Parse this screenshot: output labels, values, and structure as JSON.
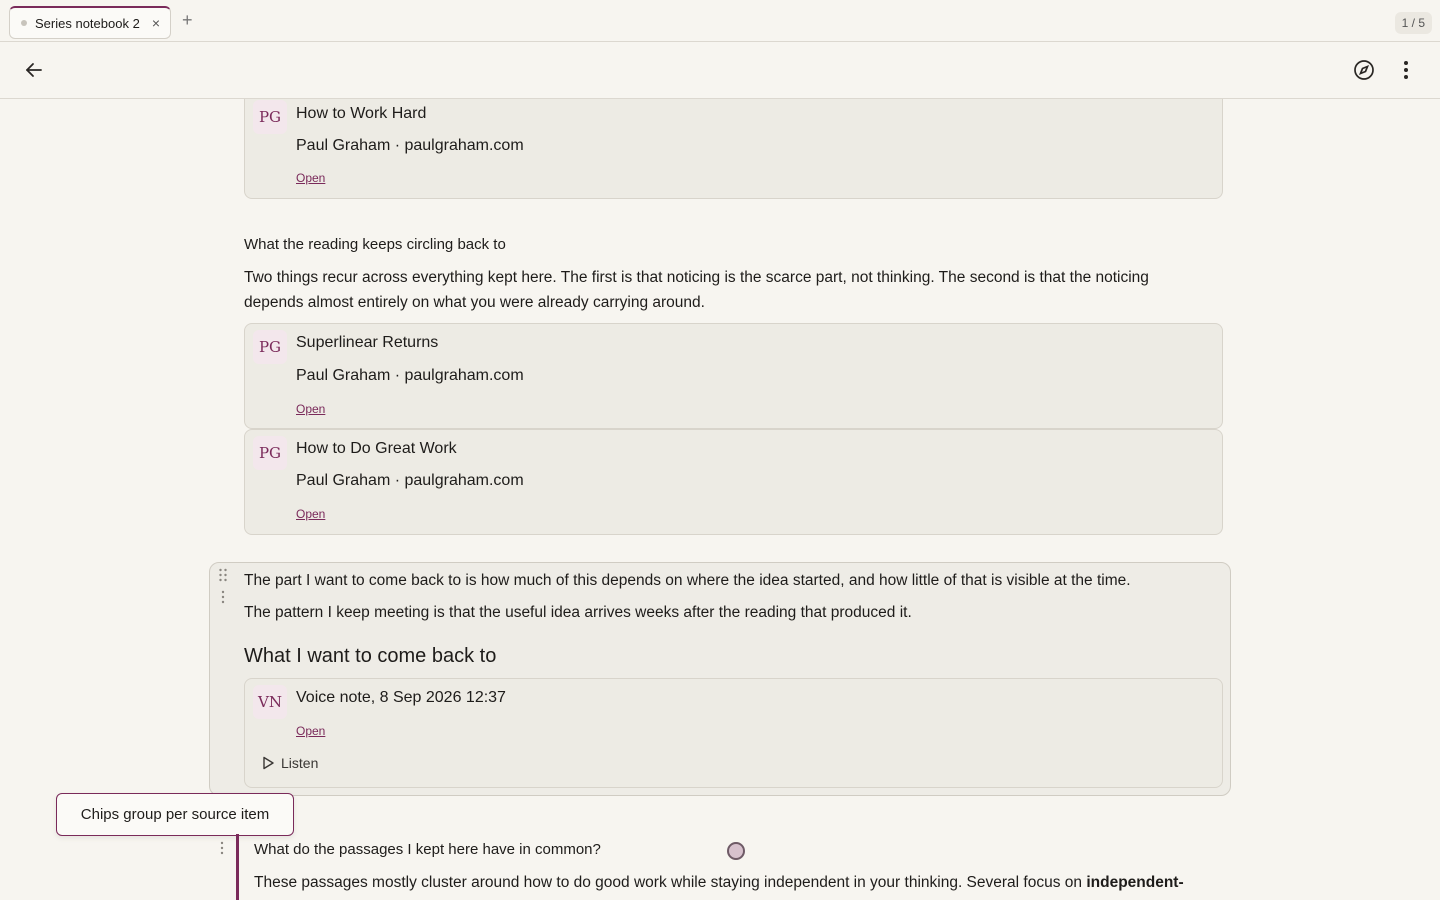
{
  "tabs": [
    {
      "label": "Series notebook 2",
      "active": true
    }
  ],
  "page_counter": "1 / 5",
  "cards": [
    {
      "initials": "PG",
      "title": "How to Work Hard",
      "meta": "Paul Graham · paulgraham.com",
      "open_label": "Open"
    },
    {
      "initials": "PG",
      "title": "Superlinear Returns",
      "meta": "Paul Graham · paulgraham.com",
      "open_label": "Open"
    },
    {
      "initials": "PG",
      "title": "How to Do Great Work",
      "meta": "Paul Graham · paulgraham.com",
      "open_label": "Open"
    },
    {
      "initials": "VN",
      "title": "Voice note, 8 Sep 2026 12:37",
      "meta": "",
      "open_label": "Open",
      "listen_label": "Listen"
    }
  ],
  "section": {
    "label": "What the reading keeps circling back to",
    "body": "Two things recur across everything kept here. The first is that noticing is the scarce part, not thinking. The second is that the noticing depends almost entirely on what you were already carrying around."
  },
  "block": {
    "para1": "The part I want to come back to is how much of this depends on where the idea started, and how little of that is visible at the time.",
    "para2": "The pattern I keep meeting is that the useful idea arrives weeks after the reading that produced it.",
    "heading": "What I want to come back to"
  },
  "tooltip": "Chips group per source item",
  "ai": {
    "question": "What do the passages I kept here have in common?",
    "answer_start": "These passages mostly cluster around how to do good work while staying independent in your thinking. Several focus on ",
    "answer_bold": "independent-"
  },
  "colors": {
    "accent": "#7a2a5a",
    "background": "#f7f5f0",
    "card": "#edebe4"
  },
  "icons": [
    "back-arrow-icon",
    "compass-icon",
    "more-vertical-icon",
    "drag-handle-icon",
    "play-icon",
    "close-icon",
    "plus-icon"
  ]
}
